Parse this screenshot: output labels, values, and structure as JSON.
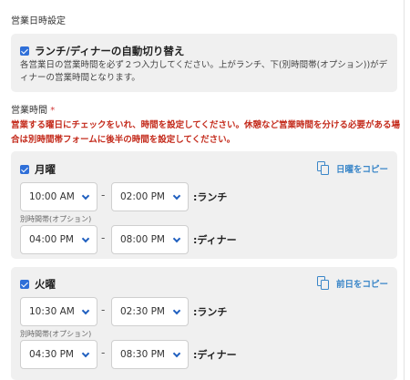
{
  "section_title": "営業日時設定",
  "lunch_dinner_toggle": {
    "checked": true,
    "label": "ランチ/ディナーの自動切り替え",
    "description": "各営業日の営業時間を必ず２つ入力してください。上がランチ、下(別時間帯(オプション))がディナーの営業時間となります。"
  },
  "hours_section": {
    "label": "営業時間",
    "required_mark": "*",
    "warning": "営業する曜日にチェックをいれ、時間を設定してください。休憩など営業時間を分ける必要がある場合は別時間帯フォームに後半の時間を設定してください。"
  },
  "days": [
    {
      "name": "月曜",
      "checked": true,
      "copy_label": "日曜をコピー",
      "primary": {
        "start": "10:00 AM",
        "end": "02:00 PM",
        "label": ":ランチ"
      },
      "alt_label": "別時間帯(オプション)",
      "secondary": {
        "start": "04:00 PM",
        "end": "08:00 PM",
        "label": ":ディナー"
      }
    },
    {
      "name": "火曜",
      "checked": true,
      "copy_label": "前日をコピー",
      "primary": {
        "start": "10:30 AM",
        "end": "02:30 PM",
        "label": ":ランチ"
      },
      "alt_label": "別時間帯(オプション)",
      "secondary": {
        "start": "04:30 PM",
        "end": "08:30 PM",
        "label": ":ディナー"
      }
    }
  ],
  "separator": "-",
  "colors": {
    "accent": "#2f6fd8",
    "link": "#3a86c8",
    "warning": "#c42b1c",
    "card_bg": "#f0f0f0"
  }
}
